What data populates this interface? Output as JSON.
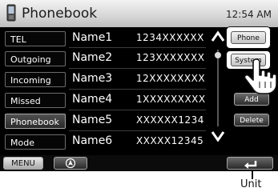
{
  "header": {
    "title": "Phonebook",
    "clock": "12:54 AM"
  },
  "left_menu": [
    {
      "label": "TEL"
    },
    {
      "label": "Outgoing"
    },
    {
      "label": "Incoming"
    },
    {
      "label": "Missed"
    },
    {
      "label": "Phonebook",
      "active": true
    },
    {
      "label": "Mode"
    }
  ],
  "contacts": [
    {
      "name": "Name1",
      "number": "1234XXXXXX"
    },
    {
      "name": "Name2",
      "number": "123XXXXXXX"
    },
    {
      "name": "Name3",
      "number": "12XXXXXXXX"
    },
    {
      "name": "Name4",
      "number": "1XXXXXXXXX"
    },
    {
      "name": "Name5",
      "number": "XXXXXX1234"
    },
    {
      "name": "Name6",
      "number": "XXXXX12345"
    }
  ],
  "right_buttons": {
    "phone": "Phone",
    "system": "System",
    "add": "Add",
    "delete": "Delete"
  },
  "bottom_bar": {
    "menu": "MENU"
  },
  "callout": {
    "label": "Unit"
  },
  "icons": {
    "phone": "phone-icon",
    "scroll_up": "chevron-up-icon",
    "scroll_down": "chevron-down-icon",
    "navigation": "navigation-icon",
    "back": "back-arrow-icon",
    "hand": "hand-pointer-icon"
  }
}
